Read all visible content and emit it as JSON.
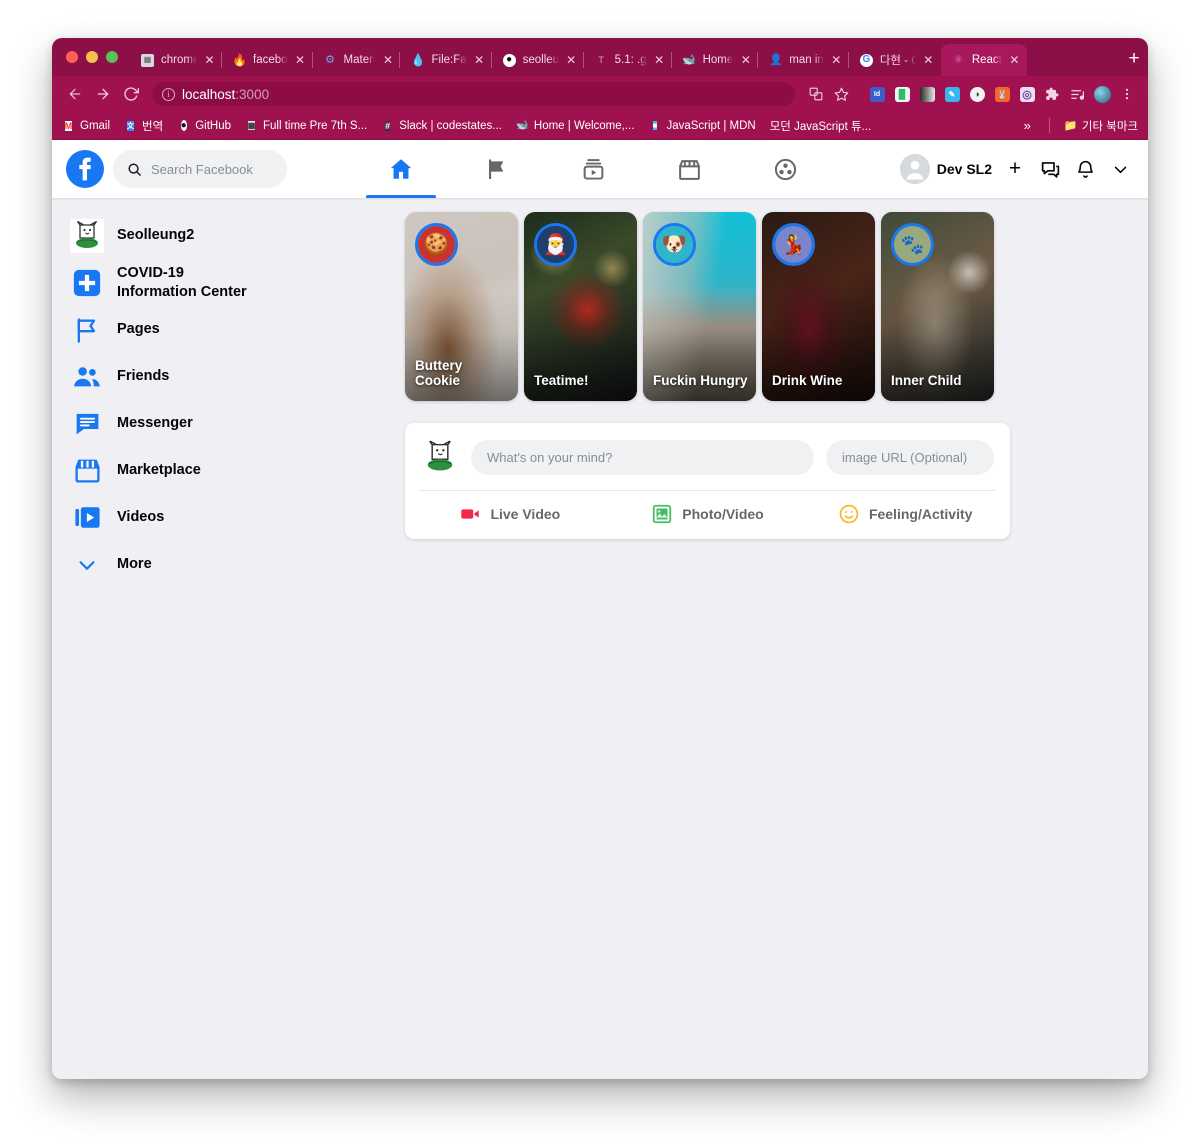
{
  "browser": {
    "tabs": [
      {
        "title": "chrome://n",
        "favicon": "page-icon",
        "active": false
      },
      {
        "title": "facebo",
        "favicon": "fire-icon",
        "active": false
      },
      {
        "title": "Materi",
        "favicon": "material-icon",
        "active": false
      },
      {
        "title": "File:Fa",
        "favicon": "wikipedia-icon",
        "active": false
      },
      {
        "title": "seolleu",
        "favicon": "github-icon",
        "active": false
      },
      {
        "title": "5.1: .g",
        "favicon": "text-icon",
        "active": false
      },
      {
        "title": "Home",
        "favicon": "home-yellow-icon",
        "active": false
      },
      {
        "title": "man in",
        "favicon": "person-icon",
        "active": false
      },
      {
        "title": "다현 - C",
        "favicon": "google-icon",
        "active": false
      },
      {
        "title": "React",
        "favicon": "react-icon",
        "active": true
      }
    ],
    "new_tab_label": "+",
    "nav": {
      "back": "←",
      "forward": "→",
      "reload": "↻"
    },
    "address": {
      "host": "localhost",
      "port": ":3000",
      "info_icon": "info-icon"
    },
    "toolbar_icons": [
      "translate-icon",
      "bookmark-star-icon"
    ],
    "extensions": [
      "indesign-ext-icon",
      "evernote-ext-icon",
      "grayscale-ext-icon",
      "colorpick-ext-icon",
      "dark-mode-ext-icon",
      "fox-ext-icon",
      "target-ext-icon",
      "puzzle-ext-icon",
      "playlist-ext-icon",
      "globe-ext-icon"
    ],
    "menu_icon": "three-dot-menu-icon",
    "bookmarks": [
      {
        "label": "Gmail",
        "icon": "gmail-icon"
      },
      {
        "label": "번역",
        "icon": "translate-bm-icon"
      },
      {
        "label": "GitHub",
        "icon": "github-bm-icon"
      },
      {
        "label": "Full time Pre 7th S...",
        "icon": "grid-bm-icon"
      },
      {
        "label": "Slack | codestates...",
        "icon": "slack-bm-icon"
      },
      {
        "label": "Home | Welcome,...",
        "icon": "home-bm-icon"
      },
      {
        "label": "JavaScript | MDN",
        "icon": "mdn-bm-icon"
      },
      {
        "label": "모던 JavaScript 튜...",
        "icon": "none"
      }
    ],
    "bookmarks_overflow": "»",
    "other_bookmarks": {
      "label": "기타 북마크",
      "icon": "folder-icon"
    }
  },
  "facebook": {
    "logo": "facebook-logo-icon",
    "search": {
      "placeholder": "Search Facebook",
      "icon": "search-icon"
    },
    "nav_items": [
      {
        "name": "home",
        "icon": "home-icon",
        "active": true
      },
      {
        "name": "pages",
        "icon": "flag-icon",
        "active": false
      },
      {
        "name": "watch",
        "icon": "video-library-icon",
        "active": false
      },
      {
        "name": "marketplace",
        "icon": "marketplace-icon",
        "active": false
      },
      {
        "name": "groups",
        "icon": "groups-icon",
        "active": false
      }
    ],
    "account": {
      "username": "Dev SL2",
      "avatar_icon": "user-avatar-icon",
      "create_icon": "plus-icon",
      "messenger_icon": "messenger-icon",
      "notifications_icon": "bell-icon",
      "dropdown_icon": "chevron-down-icon"
    },
    "sidebar": [
      {
        "label": "Seolleung2",
        "icon": "profile-avatar-icon"
      },
      {
        "label": "COVID-19\nInformation Center",
        "icon": "covid-icon",
        "two_line": true
      },
      {
        "label": "Pages",
        "icon": "flag-icon"
      },
      {
        "label": "Friends",
        "icon": "friends-icon"
      },
      {
        "label": "Messenger",
        "icon": "messenger-icon"
      },
      {
        "label": "Marketplace",
        "icon": "marketplace-icon"
      },
      {
        "label": "Videos",
        "icon": "videos-icon"
      },
      {
        "label": "More",
        "icon": "chevron-down-icon"
      }
    ],
    "stories": [
      {
        "title": "Buttery Cookie",
        "avatar": "cookie-run-avatar",
        "theme": "cookies"
      },
      {
        "title": "Teatime!",
        "avatar": "santa-avatar",
        "theme": "cocoa"
      },
      {
        "title": "Fuckin Hungry",
        "avatar": "dog-avatar",
        "theme": "city"
      },
      {
        "title": "Drink Wine",
        "avatar": "anime-avatar",
        "theme": "wine"
      },
      {
        "title": "Inner Child",
        "avatar": "pet-avatar",
        "theme": "mural"
      }
    ],
    "composer": {
      "avatar_icon": "user-avatar-icon",
      "mind_placeholder": "What's on your mind?",
      "url_placeholder": "image URL (Optional)",
      "actions": [
        {
          "label": "Live Video",
          "icon": "live-video-icon",
          "color": "#f02849"
        },
        {
          "label": "Photo/Video",
          "icon": "photo-video-icon",
          "color": "#45bd62"
        },
        {
          "label": "Feeling/Activity",
          "icon": "feeling-activity-icon",
          "color": "#f7b928"
        }
      ]
    }
  },
  "colors": {
    "brand_blue": "#1877f2",
    "chrome_bg": "#a0124f",
    "tabstrip_bg": "#8c0f47",
    "active_tab_bg": "#a8185c",
    "page_bg": "#f0f0f4"
  }
}
